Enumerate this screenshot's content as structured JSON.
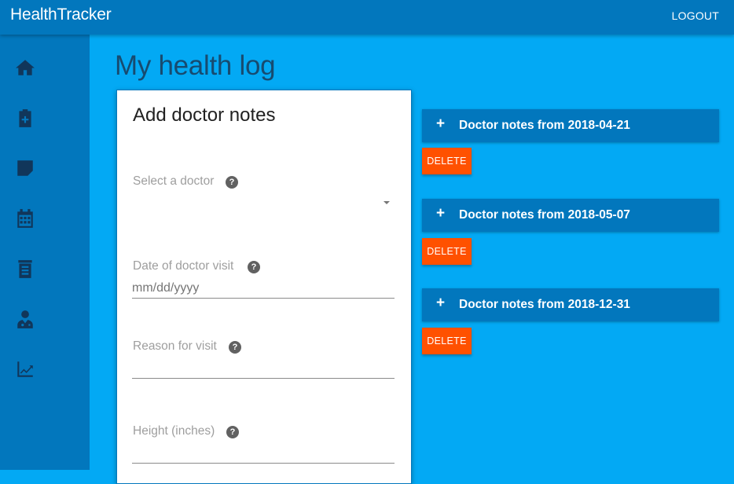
{
  "header": {
    "app_title": "HealthTracker",
    "logout_label": "LOGOUT"
  },
  "sidebar": {
    "items": [
      {
        "icon": "home-icon"
      },
      {
        "icon": "clipboard-plus-icon"
      },
      {
        "icon": "note-icon"
      },
      {
        "icon": "calendar-icon"
      },
      {
        "icon": "document-list-icon"
      },
      {
        "icon": "doctor-icon"
      },
      {
        "icon": "chart-line-icon"
      }
    ]
  },
  "main": {
    "title": "My health log",
    "form": {
      "title": "Add doctor notes",
      "doctor_label": "Select a doctor",
      "date_label": "Date of doctor visit",
      "date_placeholder": "mm/dd/yyyy",
      "reason_label": "Reason for visit",
      "height_label": "Height (inches)",
      "help_glyph": "?"
    },
    "notes": [
      {
        "title": "Doctor notes from 2018-04-21",
        "delete_label": "DELETE"
      },
      {
        "title": "Doctor notes from 2018-05-07",
        "delete_label": "DELETE"
      },
      {
        "title": "Doctor notes from 2018-12-31",
        "delete_label": "DELETE"
      }
    ],
    "expand_glyph": "+"
  },
  "colors": {
    "primary": "#0277bd",
    "background": "#03a9f4",
    "accent": "#ff5100",
    "icon": "#11365a"
  }
}
